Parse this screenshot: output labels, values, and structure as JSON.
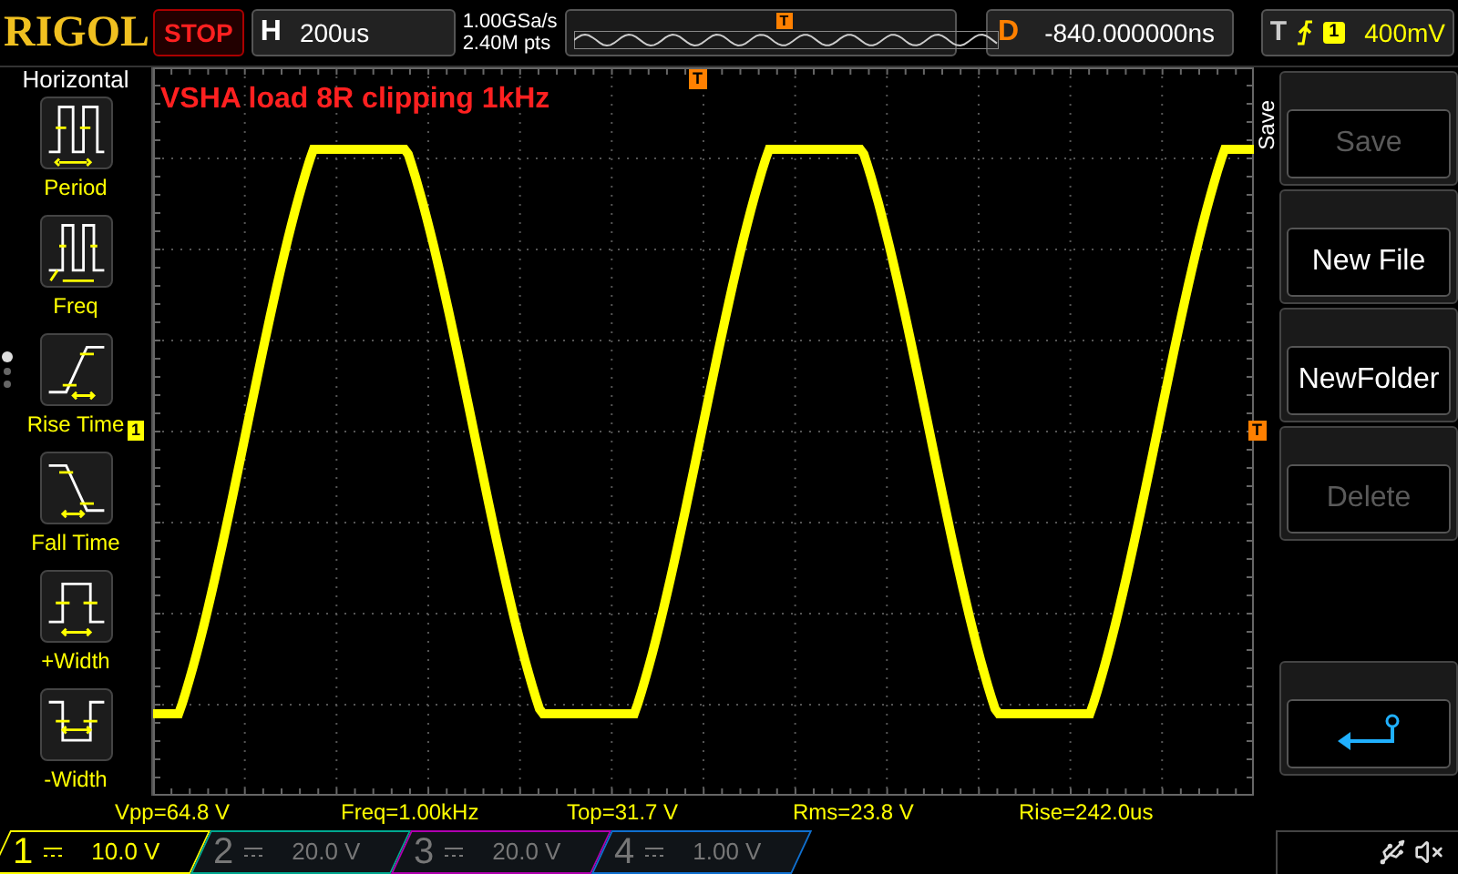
{
  "header": {
    "logo": "RIGOL",
    "run_state": "STOP",
    "horizontal": {
      "label": "H",
      "timebase": "200us"
    },
    "sample_rate": "1.00GSa/s",
    "memory_depth": "2.40M pts",
    "trigger_marker": "T",
    "delay": {
      "label": "D",
      "value": "-840.000000ns"
    },
    "trigger": {
      "label": "T",
      "source": "1",
      "level": "400mV"
    }
  },
  "menu": {
    "title": "Horizontal",
    "pages": [
      {
        "selected": true
      },
      {
        "selected": false
      },
      {
        "selected": false
      }
    ],
    "items": [
      {
        "label": "Period",
        "kind": "period"
      },
      {
        "label": "Freq",
        "kind": "freq"
      },
      {
        "label": "Rise Time",
        "kind": "rise"
      },
      {
        "label": "Fall Time",
        "kind": "fall"
      },
      {
        "label": "+Width",
        "kind": "pwidth"
      },
      {
        "label": "-Width",
        "kind": "nwidth"
      }
    ]
  },
  "screen": {
    "annotation": "VSHA load 8R clipping 1kHz",
    "trigger_position_marker": "T",
    "channel_marker": "1",
    "trigger_level_marker": "T"
  },
  "softkeys": {
    "title": "Save",
    "buttons": [
      {
        "kind": "text",
        "label": "Save",
        "disabled": true
      },
      {
        "kind": "text",
        "label": "New File",
        "disabled": false
      },
      {
        "kind": "text",
        "label": "NewFolder",
        "disabled": false
      },
      {
        "kind": "text",
        "label": "Delete",
        "disabled": true
      },
      {
        "kind": "spacer"
      },
      {
        "kind": "back"
      }
    ]
  },
  "measurements": [
    "Vpp=64.8 V",
    "Freq=1.00kHz",
    "Top=31.7 V",
    "Rms=23.8 V",
    "Rise=242.0us"
  ],
  "channels": [
    {
      "number": "1",
      "scale": "10.0 V",
      "active": true,
      "color": "#ffff00"
    },
    {
      "number": "2",
      "scale": "20.0 V",
      "active": false,
      "color": "#00a890"
    },
    {
      "number": "3",
      "scale": "20.0 V",
      "active": false,
      "color": "#b000b0"
    },
    {
      "number": "4",
      "scale": "1.00 V",
      "active": false,
      "color": "#1070d0"
    }
  ]
}
